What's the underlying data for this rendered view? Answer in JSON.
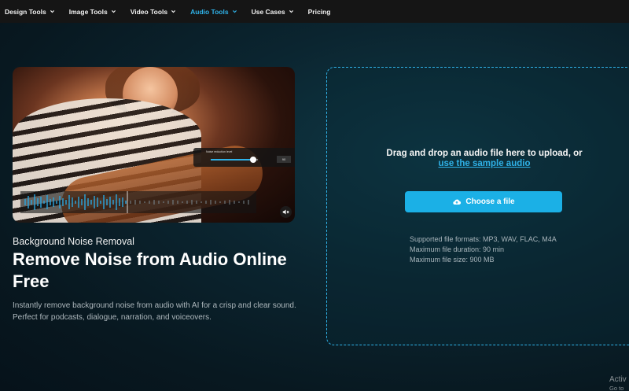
{
  "nav": {
    "items": [
      {
        "label": "Design Tools",
        "dropdown": true,
        "active": false
      },
      {
        "label": "Image Tools",
        "dropdown": true,
        "active": false
      },
      {
        "label": "Video Tools",
        "dropdown": true,
        "active": false
      },
      {
        "label": "Audio Tools",
        "dropdown": true,
        "active": true
      },
      {
        "label": "Use Cases",
        "dropdown": true,
        "active": false
      },
      {
        "label": "Pricing",
        "dropdown": false,
        "active": false
      }
    ]
  },
  "hero": {
    "eyebrow": "Background Noise Removal",
    "title": "Remove Noise from Audio Online Free",
    "description": "Instantly remove background noise from audio with AI for a crisp and clear sound. Perfect for podcasts, dialogue, narration, and voiceovers.",
    "slider_label": "Noise reduction level",
    "slider_value": "90",
    "slider_fraction": 0.9
  },
  "upload": {
    "prompt": "Drag and drop an audio file here to upload, or",
    "sample_link": "use the sample audio",
    "button_label": "Choose a file",
    "specs": [
      "Supported file formats: MP3, WAV, FLAC, M4A",
      "Maximum file duration: 90 min",
      "Maximum file size: 900 MB"
    ]
  },
  "watermark": {
    "line1": "Activ",
    "line2": "Go to S"
  },
  "colors": {
    "accent": "#1bb0e6",
    "nav_active": "#2fb2e8",
    "background": "#0b2530"
  },
  "icons": {
    "dropdown": "chevron-down-icon",
    "upload": "cloud-upload-icon",
    "mute": "speaker-muted-icon"
  }
}
